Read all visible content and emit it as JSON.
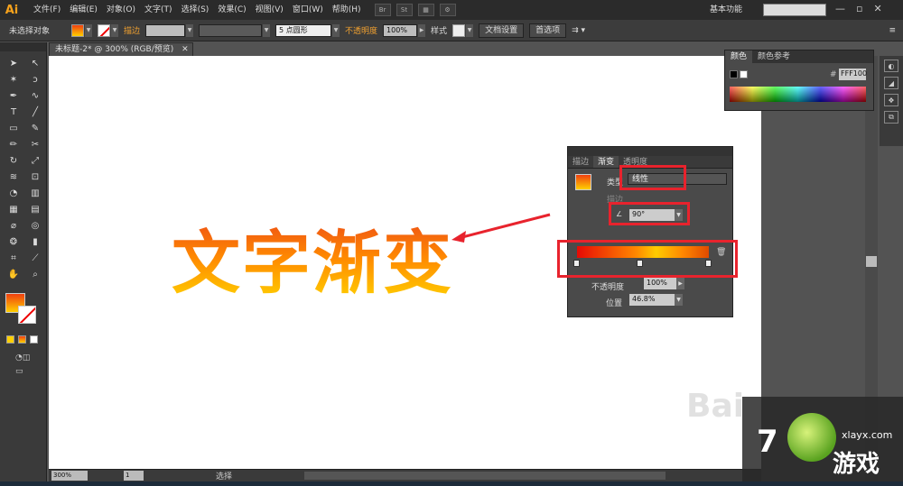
{
  "app": {
    "logo": "Ai"
  },
  "menu": [
    "文件(F)",
    "编辑(E)",
    "对象(O)",
    "文字(T)",
    "选择(S)",
    "效果(C)",
    "视图(V)",
    "窗口(W)",
    "帮助(H)"
  ],
  "menubar_icons": {
    "br": "Br",
    "st": "St"
  },
  "workspace": "基本功能",
  "window_controls": {
    "minimize": "—",
    "restore": "▫",
    "close": "✕"
  },
  "control_bar": {
    "selection_label": "未选择对象",
    "stroke_label": "描边",
    "brush_label": "5 点圆形",
    "opacity_label": "不透明度",
    "opacity_value": "100%",
    "style_label": "样式",
    "doc_setup": "文档设置",
    "preferences": "首选项"
  },
  "document_tab": "未标题-2* @ 300% (RGB/预览)",
  "canvas": {
    "text": "文字渐变"
  },
  "status": {
    "zoom": "300%",
    "artboard": "1",
    "tool": "选择"
  },
  "color_panel": {
    "tabs": [
      "颜色",
      "颜色参考"
    ],
    "hex_label": "#",
    "hex": "FFF100"
  },
  "gradient_panel": {
    "tabs": [
      "描边",
      "渐变",
      "透明度"
    ],
    "type_label": "类型",
    "type_value": "线性",
    "stroke_label": "描边",
    "angle_value": "90°",
    "opacity_label": "不透明度",
    "opacity_value": "100%",
    "position_label": "位置",
    "position_value": "46.8%"
  },
  "watermark": {
    "baidu": "Bai",
    "badge_number": "7",
    "badge_url": "xlayx.com",
    "badge_name": "游戏"
  },
  "colors": {
    "gradient_start": "#f15a12",
    "gradient_end": "#ffd000",
    "highlight": "#e8232d",
    "canvas_bg": "#ffffff"
  },
  "icons": [
    "selection-tool-icon",
    "direct-selection-icon",
    "magic-wand-icon",
    "lasso-icon",
    "pen-icon",
    "type-icon",
    "line-icon",
    "rectangle-icon",
    "brush-icon",
    "pencil-icon",
    "eraser-icon",
    "rotate-icon",
    "scale-icon",
    "warp-icon",
    "free-transform-icon",
    "symbol-sprayer-icon",
    "graph-icon",
    "mesh-icon",
    "gradient-icon",
    "eyedropper-icon",
    "blend-icon",
    "artboard-icon",
    "slice-icon",
    "hand-icon",
    "zoom-icon",
    "trash-icon"
  ]
}
